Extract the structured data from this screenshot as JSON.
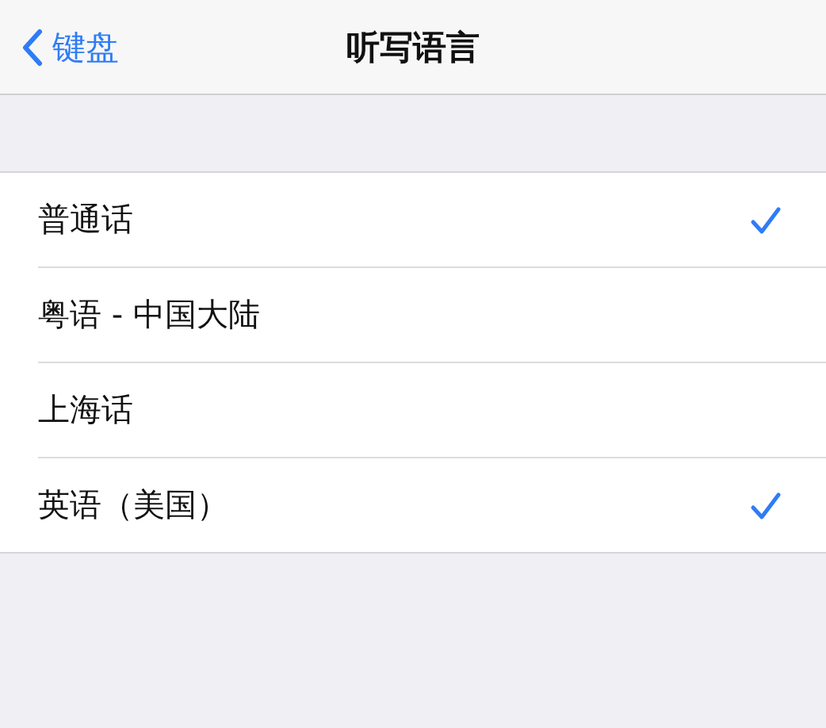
{
  "nav": {
    "back": "键盘",
    "title": "听写语言"
  },
  "languages": [
    {
      "label": "普通话",
      "checked": true
    },
    {
      "label": "粤语 - 中国大陆",
      "checked": false
    },
    {
      "label": "上海话",
      "checked": false
    },
    {
      "label": "英语（美国）",
      "checked": true
    }
  ]
}
